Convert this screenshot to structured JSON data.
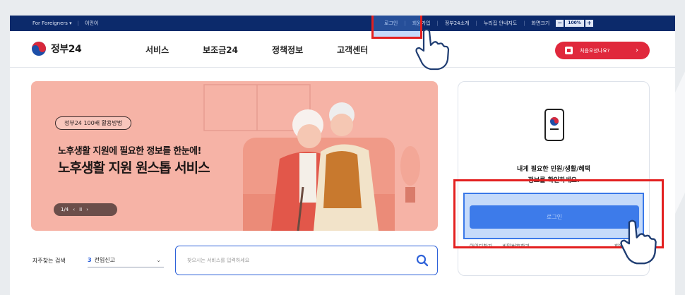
{
  "utility_bar": {
    "for_foreigners": "For Foreigners ▾",
    "english": "이민이",
    "login": "로그인",
    "signup": "회원가입",
    "about": "정부24소개",
    "sitemap": "누리집 안내지도",
    "zoom_label": "화면크기",
    "zoom_value": "100%",
    "zoom_minus": "−",
    "zoom_plus": "+"
  },
  "nav": {
    "logo_text": "정부24",
    "menu": [
      "서비스",
      "보조금24",
      "정책정보",
      "고객센터"
    ],
    "cta_label": "처음오셨나요?",
    "cta_arrow": "›"
  },
  "banner": {
    "chip": "정부24 100배 활용방법",
    "subtitle": "노후생활 지원에 필요한 정보를 한눈에!",
    "title": "노후생활 지원 원스톱 서비스",
    "pager_text": "1/4",
    "pager_prev": "‹",
    "pager_pause": "II",
    "pager_next": "›"
  },
  "faq": {
    "label": "자주찾는 검색",
    "selected_num": "3",
    "selected_text": "전입신고",
    "chevron": "⌄"
  },
  "search": {
    "placeholder": "찾으시는 서비스를 입력하세요"
  },
  "login_card": {
    "line1": "내게 필요한 민원/생활/혜택",
    "line2": "정보를 확인하세요.",
    "login_button": "로그인",
    "link_find_id": "아이디찾기",
    "link_find_pw": "비밀번호찾기",
    "link_signup": "회원"
  },
  "colors": {
    "utility_bar": "#0c2a6b",
    "accent_blue": "#2f6ee6",
    "cta_red": "#e0283c",
    "banner_bg": "#f6b3a6",
    "highlight_red": "#e32020"
  }
}
